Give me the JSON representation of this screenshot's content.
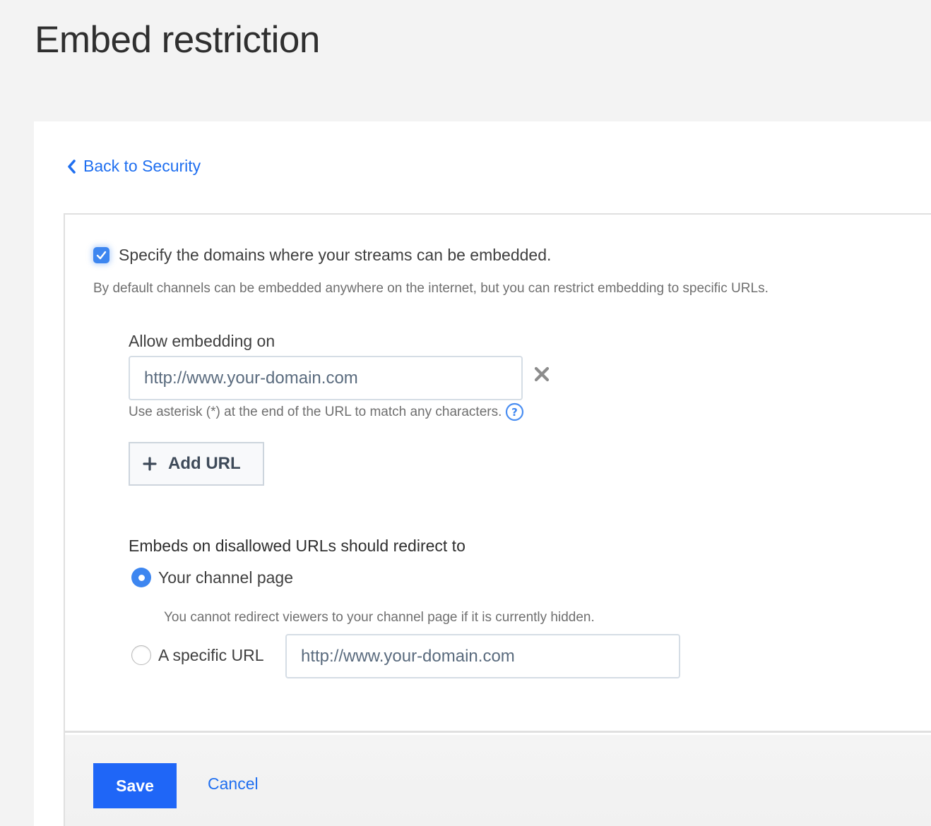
{
  "page": {
    "title": "Embed restriction"
  },
  "nav": {
    "back_label": "Back to Security",
    "back_icon": "chevron-left-icon"
  },
  "restriction": {
    "enabled": true,
    "checkbox_label": "Specify the domains where your streams can be embedded.",
    "description": "By default channels can be embedded anywhere on the internet, but you can restrict embedding to specific URLs."
  },
  "allow": {
    "label": "Allow embedding on",
    "urls": [
      {
        "value": "",
        "placeholder": "http://www.your-domain.com"
      }
    ],
    "remove_icon": "close-icon",
    "hint": "Use asterisk (*) at the end of the URL to match any characters.",
    "help_icon": "question-circle-icon",
    "add_button_label": "Add URL",
    "add_button_icon": "plus-icon"
  },
  "redirect": {
    "label": "Embeds on disallowed URLs should redirect to",
    "selected": "channel_page",
    "options": [
      {
        "id": "channel_page",
        "label": "Your channel page",
        "hint": "You cannot redirect viewers to your channel page if it is currently hidden."
      },
      {
        "id": "specific_url",
        "label": "A specific URL",
        "input_value": "",
        "input_placeholder": "http://www.your-domain.com"
      }
    ]
  },
  "footer": {
    "save_label": "Save",
    "cancel_label": "Cancel"
  },
  "colors": {
    "accent": "#1f66f7",
    "link": "#1f6ff0",
    "checkbox": "#3d86f0",
    "background": "#f3f3f3"
  }
}
